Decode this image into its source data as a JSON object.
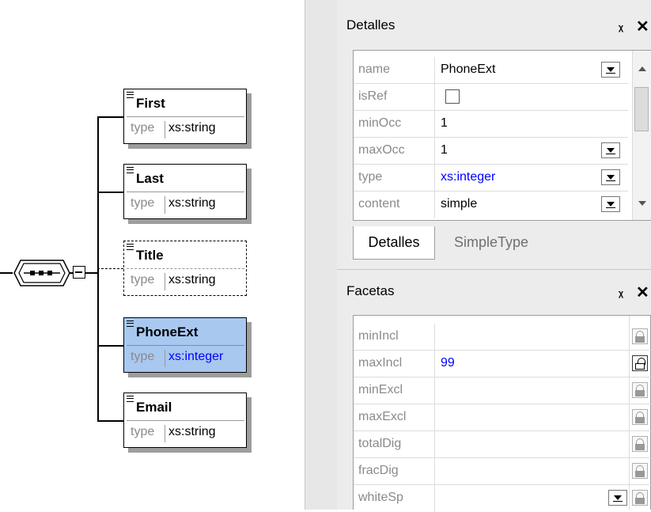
{
  "schema": {
    "elements": [
      {
        "name": "First",
        "type_label": "type",
        "type": "xs:string"
      },
      {
        "name": "Last",
        "type_label": "type",
        "type": "xs:string"
      },
      {
        "name": "Title",
        "type_label": "type",
        "type": "xs:string"
      },
      {
        "name": "PhoneExt",
        "type_label": "type",
        "type": "xs:integer"
      },
      {
        "name": "Email",
        "type_label": "type",
        "type": "xs:string"
      }
    ]
  },
  "details_panel": {
    "title": "Detalles",
    "rows": [
      {
        "key": "name",
        "value": "PhoneExt"
      },
      {
        "key": "isRef",
        "value": ""
      },
      {
        "key": "minOcc",
        "value": "1"
      },
      {
        "key": "maxOcc",
        "value": "1"
      },
      {
        "key": "type",
        "value": "xs:integer"
      },
      {
        "key": "content",
        "value": "simple"
      }
    ],
    "tabs": [
      {
        "label": "Detalles",
        "active": true
      },
      {
        "label": "SimpleType",
        "active": false
      }
    ]
  },
  "facets_panel": {
    "title": "Facetas",
    "rows": [
      {
        "key": "minIncl",
        "value": ""
      },
      {
        "key": "maxIncl",
        "value": "99"
      },
      {
        "key": "minExcl",
        "value": ""
      },
      {
        "key": "maxExcl",
        "value": ""
      },
      {
        "key": "totalDig",
        "value": ""
      },
      {
        "key": "fracDig",
        "value": ""
      },
      {
        "key": "whiteSp",
        "value": ""
      }
    ]
  },
  "icons": {
    "pin": "pin-icon",
    "close": "close-icon",
    "sequence": "sequence-compositor-icon",
    "lock": "lock-icon"
  },
  "colors": {
    "selected_bg": "#a8c8f0",
    "value_blue": "#0000ff",
    "panel_bg": "#ececec"
  }
}
